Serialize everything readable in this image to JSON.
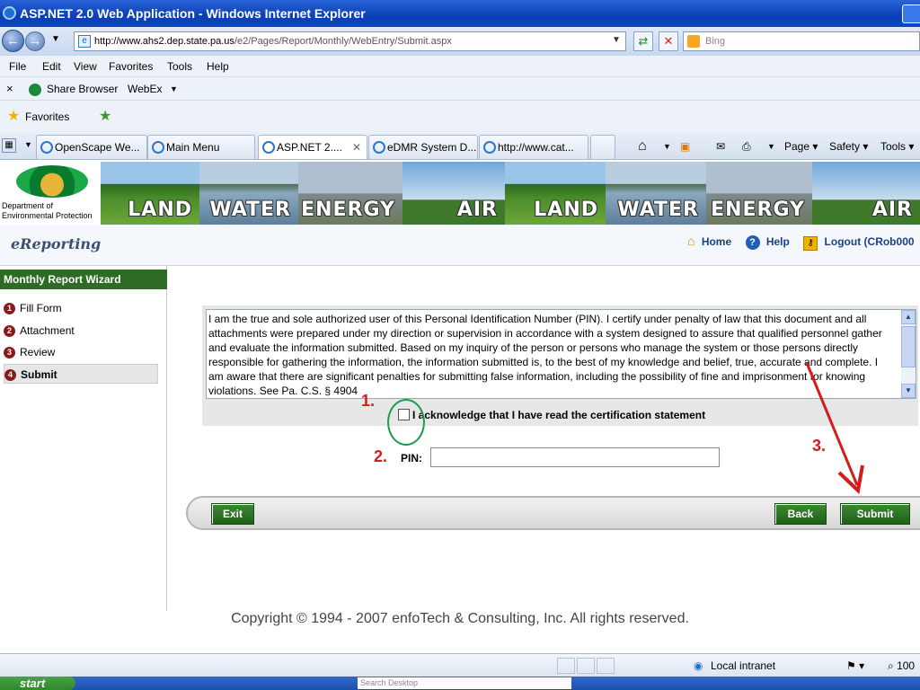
{
  "window": {
    "title": "ASP.NET 2.0 Web Application - Windows Internet Explorer"
  },
  "address": {
    "url_host": "http://www.ahs2.dep.state.pa.us",
    "url_path": "/e2/Pages/Report/Monthly/WebEntry/Submit.aspx",
    "search_placeholder": "Bing"
  },
  "menu": {
    "items": [
      "File",
      "Edit",
      "View",
      "Favorites",
      "Tools",
      "Help"
    ]
  },
  "links": {
    "share": "Share Browser",
    "webex": "WebEx"
  },
  "favorites": {
    "label": "Favorites"
  },
  "tabs": [
    {
      "label": "OpenScape We..."
    },
    {
      "label": "Main Menu"
    },
    {
      "label": "ASP.NET 2...."
    },
    {
      "label": "eDMR System D..."
    },
    {
      "label": "http://www.cat..."
    }
  ],
  "commands": {
    "page": "Page",
    "safety": "Safety",
    "tools": "Tools"
  },
  "logo": {
    "line1": "Department of",
    "line2": "Environmental Protection"
  },
  "banner": {
    "panels": [
      "LAND",
      "WATER",
      "ENERGY",
      "AIR",
      "LAND",
      "WATER",
      "ENERGY",
      "AIR"
    ]
  },
  "header": {
    "brand": "eReporting",
    "home": "Home",
    "help": "Help",
    "logout": "Logout (CRob000"
  },
  "sidebar": {
    "title": "Monthly Report Wizard",
    "steps": [
      {
        "num": "1",
        "label": "Fill Form"
      },
      {
        "num": "2",
        "label": "Attachment"
      },
      {
        "num": "3",
        "label": "Review"
      },
      {
        "num": "4",
        "label": "Submit"
      }
    ]
  },
  "certification": {
    "text": "I am the true and sole authorized user of this Personal Identification Number (PIN).  I certify under penalty of law that this document and all attachments were prepared under my direction or supervision in accordance with a system designed to assure that qualified personnel gather and evaluate the information submitted. Based on my inquiry of the person or persons who manage the system or those persons directly responsible for gathering the information, the information submitted is, to the best of my knowledge and belief, true, accurate and complete.  I am aware that there are significant penalties for submitting false information, including the possibility of fine and imprisonment for knowing violations.  See Pa. C.S. § 4904",
    "acknowledge": "I acknowledge that I have read the certification statement"
  },
  "annotations": {
    "one": "1.",
    "two": "2.",
    "three": "3."
  },
  "form": {
    "pin_label": "PIN:",
    "pin_value": ""
  },
  "buttons": {
    "exit": "Exit",
    "back": "Back",
    "submit": "Submit"
  },
  "footer": {
    "copyright": "Copyright © 1994 - 2007 enfoTech & Consulting, Inc. All rights reserved."
  },
  "status": {
    "zone": "Local intranet",
    "zoom": "100"
  },
  "taskbar": {
    "start": "start",
    "search": "Search Desktop"
  },
  "colors": {
    "accent_green": "#2e6b25",
    "annotation_red": "#d41c1c",
    "circle_green": "#1e9a52"
  }
}
